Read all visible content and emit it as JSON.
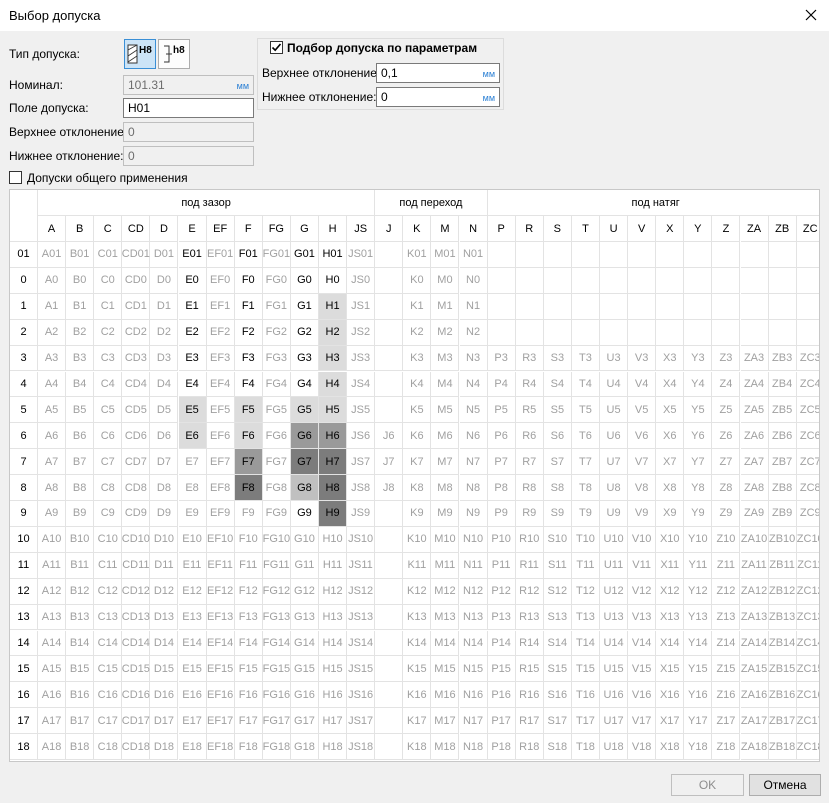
{
  "window": {
    "title": "Выбор допуска"
  },
  "left": {
    "type_label": "Тип допуска:",
    "type_btn_hole": "H8",
    "type_btn_shaft": "h8",
    "nominal_label": "Номинал:",
    "nominal_value": "101.31",
    "nominal_unit": "мм",
    "field_label": "Поле допуска:",
    "field_value": "H01",
    "upper_label": "Верхнее отклонение:",
    "upper_value": "0",
    "lower_label": "Нижнее отклонение:",
    "lower_value": "0",
    "general_label": "Допуски общего применения"
  },
  "params": {
    "title": "Подбор допуска по параметрам",
    "upper_label": "Верхнее отклонение:",
    "upper_value": "0,1",
    "upper_unit": "мм",
    "lower_label": "Нижнее отклонение:",
    "lower_value": "0",
    "lower_unit": "мм"
  },
  "grid": {
    "groups": [
      {
        "label": "под зазор",
        "span": 12
      },
      {
        "label": "под переход",
        "span": 4
      },
      {
        "label": "под натяг",
        "span": 12
      }
    ],
    "columns": [
      "A",
      "B",
      "C",
      "CD",
      "D",
      "E",
      "EF",
      "F",
      "FG",
      "G",
      "H",
      "JS",
      "J",
      "K",
      "M",
      "N",
      "P",
      "R",
      "S",
      "T",
      "U",
      "V",
      "X",
      "Y",
      "Z",
      "ZA",
      "ZB",
      "ZC"
    ],
    "rows": [
      "01",
      "0",
      "1",
      "2",
      "3",
      "4",
      "5",
      "6",
      "7",
      "8",
      "9",
      "10",
      "11",
      "12",
      "13",
      "14",
      "15",
      "16",
      "17",
      "18"
    ]
  },
  "buttons": {
    "ok": "OK",
    "cancel": "Отмена"
  }
}
